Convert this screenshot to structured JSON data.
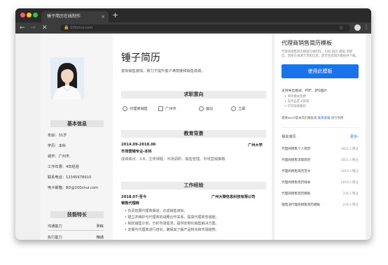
{
  "browser": {
    "tab_title": "锤子简历在线制作",
    "tab_close": "×",
    "new_tab": "+",
    "url": "100chui.com",
    "back": "←",
    "forward": "→",
    "stop": "✕",
    "star": "☆",
    "menu": "⋮"
  },
  "resume": {
    "name": "锤子简历",
    "intro": "富有销售激情，致力于提升客户满意度和销售成绩。",
    "left": {
      "basic_header": "基本信息",
      "info": [
        "年龄：31岁",
        "学历：本科",
        "城市：广州市",
        "工作年限：4年经验",
        "联系电话：12345678910",
        "电子邮箱：BD@100chui.com"
      ],
      "skills_header": "技能特长",
      "skills": [
        {
          "name": "沟通能力",
          "level": "熟练"
        },
        {
          "name": "执行能力",
          "level": "精通"
        }
      ]
    },
    "intent": {
      "header": "求职意向",
      "items": [
        "代理商销售",
        "广州市",
        "面议",
        "立即"
      ]
    },
    "education": {
      "header": "教育背景",
      "date": "2014.09-2018.06",
      "school": "广州大学",
      "major": "市场营销专业-本科",
      "courses": "成绩绩点：3.8，主修课程：市场调研、销售管理、市场营销策略"
    },
    "experience": {
      "header": "工作经验",
      "date": "2018.07-至今",
      "company": "广州大黎信息科技有限公司",
      "position": "销售代理商",
      "bullets": [
        "• 负责拓展代理商渠道，达成销售目标。",
        "• 建立并维护与代理商的战略合作关系，提高代理商忠诚度。",
        "• 制定销售计划，分析市场需求，提供定制化销售解决方案。",
        "• 定期与代理商进行培训，确保其了解产品特点和市场趋势。"
      ]
    }
  },
  "panel": {
    "title": "代理商销售简历模板",
    "desc": "代理商销售简历模板在线制作，包括:简历-模版-求职信，直接在线填写求职信息，即可生成简历模板并下载。",
    "use_button": "使用此模板",
    "support": "支持导出格式：PDF、JPG图片",
    "support_items": [
      "简单模式免费",
      "支持自定义排版",
      "打印效果最好"
    ],
    "prompt_pre": "需要word版本简历模板请",
    "prompt_link": "联系客服",
    "prompt_post": "进行免费",
    "related_title": "相关简历",
    "more": "更多›",
    "related": [
      {
        "name": "代理商销售个人简历",
        "count": "3821人用过"
      },
      {
        "name": "代理商销售求职简历",
        "count": "3821人用过"
      },
      {
        "name": "代理商销售简历范文",
        "count": "1815人用过"
      },
      {
        "name": "代理商销售简历样本",
        "count": "1816人用过"
      },
      {
        "name": "代理商销售简历模板",
        "count": "226人用过"
      },
      {
        "name": "锂电池代理商销售简历模板",
        "count": "226人用过"
      }
    ]
  },
  "colors": {
    "accent": "#1a73e8",
    "section_bar": "#ececec",
    "chrome_dark": "#2b2b2b"
  }
}
